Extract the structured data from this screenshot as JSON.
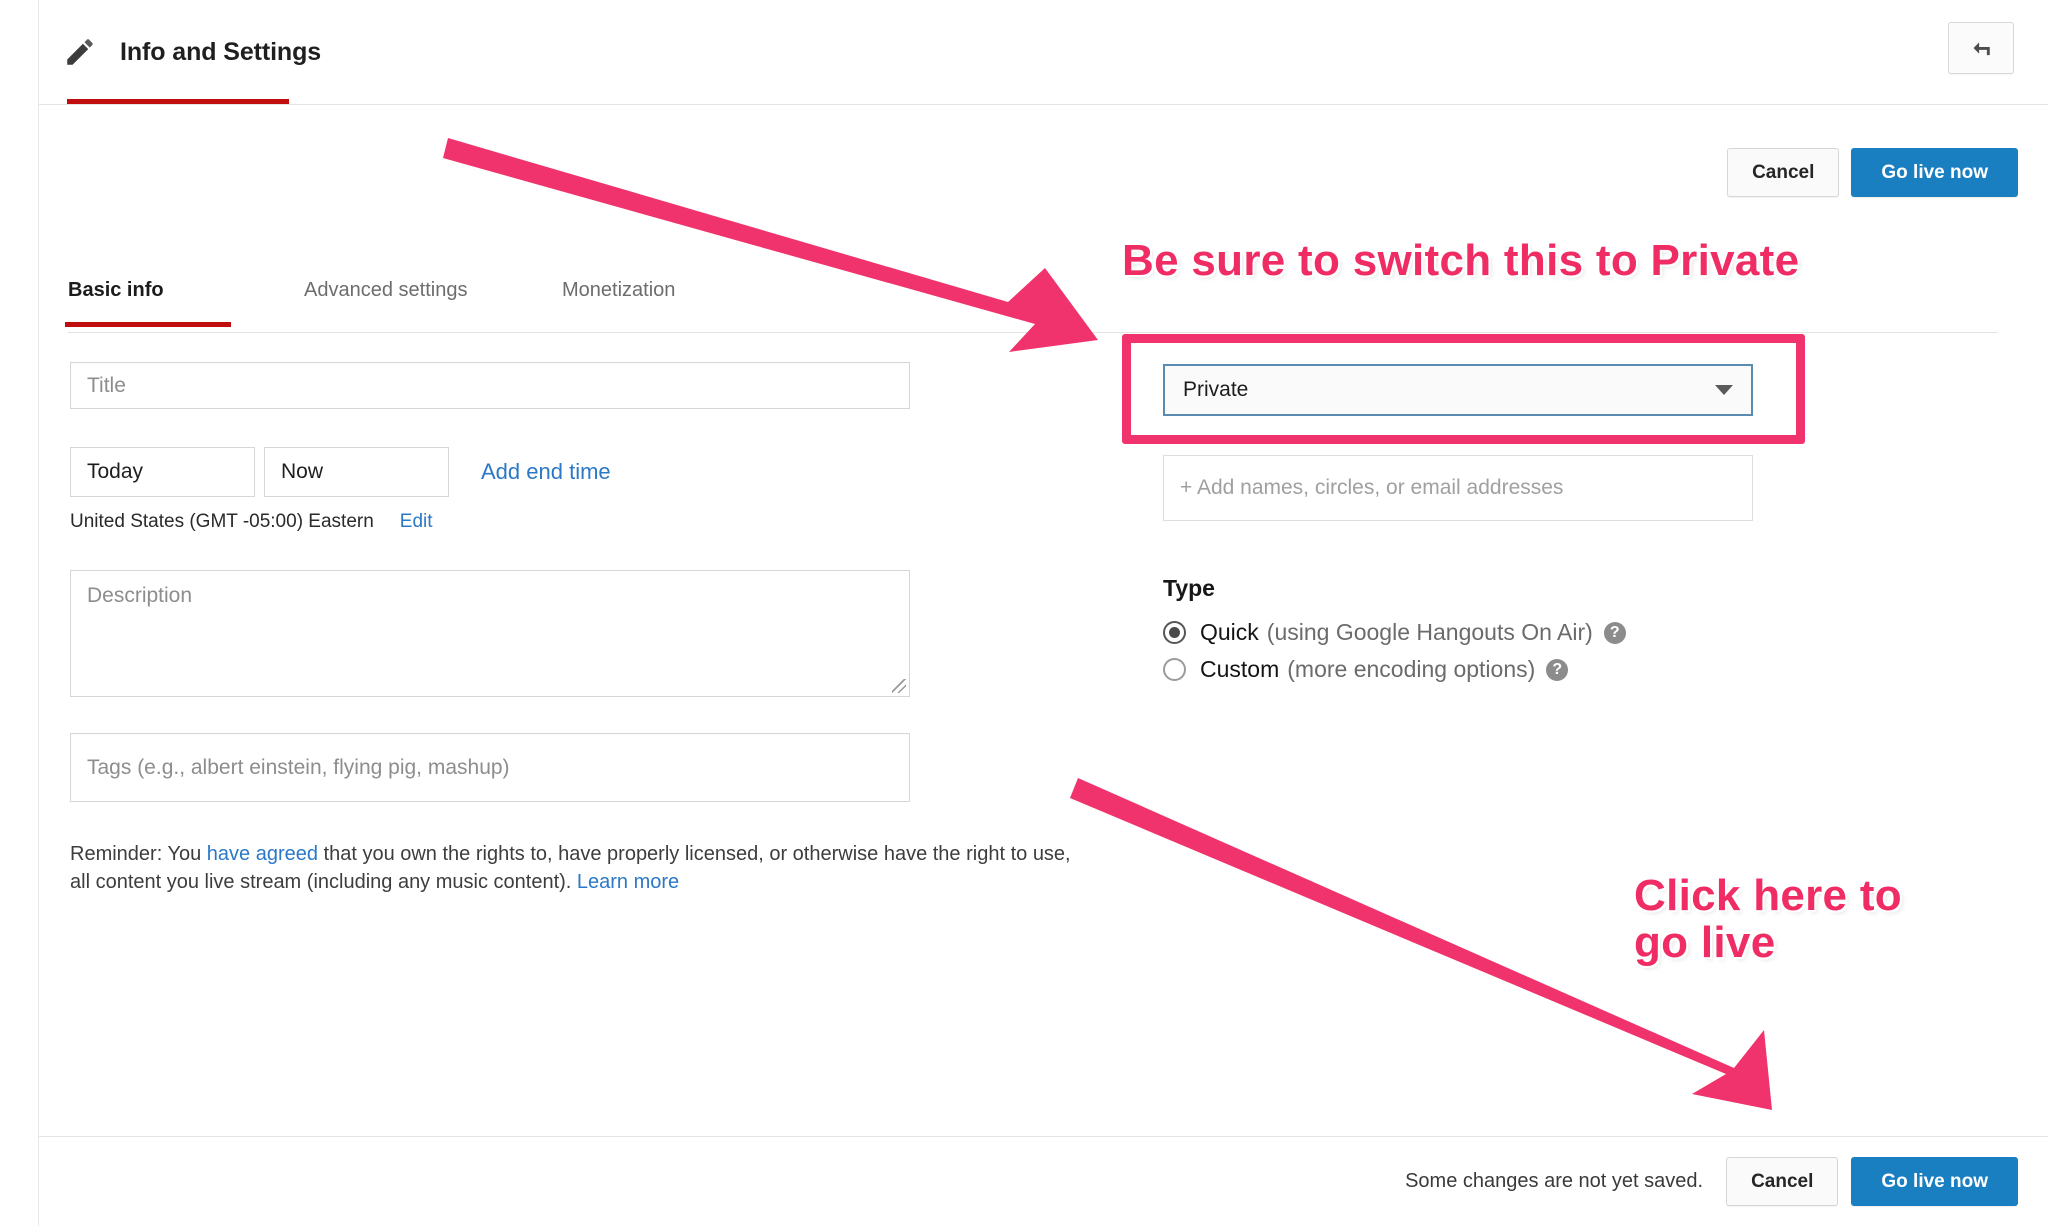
{
  "header": {
    "title": "Info and Settings",
    "pencil_icon": "pencil-icon",
    "back_icon": "back-arrow-icon"
  },
  "top_actions": {
    "cancel_label": "Cancel",
    "go_live_label": "Go live now"
  },
  "tabs": [
    {
      "label": "Basic info",
      "active": true
    },
    {
      "label": "Advanced settings",
      "active": false
    },
    {
      "label": "Monetization",
      "active": false
    }
  ],
  "basic_info": {
    "title_placeholder": "Title",
    "date_value": "Today",
    "time_value": "Now",
    "add_end_time_label": "Add end time",
    "timezone_text": "United States (GMT -05:00) Eastern",
    "timezone_edit_label": "Edit",
    "description_placeholder": "Description",
    "tags_placeholder": "Tags (e.g., albert einstein, flying pig, mashup)",
    "reminder": {
      "prefix": "Reminder: You ",
      "link1": "have agreed",
      "middle": " that you own the rights to, have properly licensed, or otherwise have the right to use, all content you live stream (including any music content). ",
      "link2": "Learn more"
    }
  },
  "privacy": {
    "selected": "Private",
    "share_placeholder": "+ Add names, circles, or email addresses"
  },
  "type": {
    "label": "Type",
    "options": [
      {
        "name": "Quick",
        "detail": "(using Google Hangouts On Air)",
        "checked": true,
        "help": "?"
      },
      {
        "name": "Custom",
        "detail": "(more encoding options)",
        "checked": false,
        "help": "?"
      }
    ]
  },
  "bottom_bar": {
    "save_status": "Some changes are not yet saved.",
    "cancel_label": "Cancel",
    "go_live_label": "Go live now"
  },
  "annotations": {
    "privacy_note": "Be sure to switch this to Private",
    "go_live_note_line1": "Click here to",
    "go_live_note_line2": "go live"
  },
  "colors": {
    "accent_red": "#c00d0d",
    "primary_blue": "#1a7fc1",
    "link_blue": "#2b78c6",
    "annotation_pink": "#ef2d64",
    "highlight_pink": "#f0336c"
  }
}
